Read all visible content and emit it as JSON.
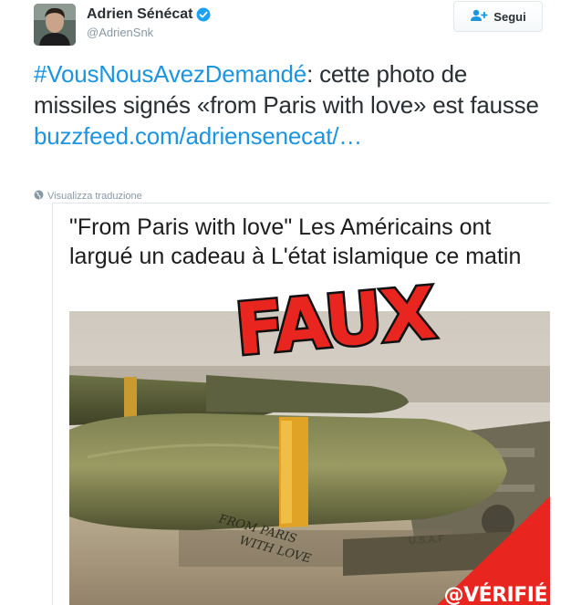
{
  "author": {
    "name": "Adrien Sénécat",
    "handle": "@AdrienSnk",
    "verified": true
  },
  "follow_button": {
    "label": "Segui",
    "icon": "add-user-icon"
  },
  "tweet": {
    "hashtag": "#VousNousAvezDemandé",
    "text": ": cette photo de missiles signés «from Paris with love» est fausse",
    "link": "buzzfeed.com/adriensenecat/…"
  },
  "translate": {
    "label": "Visualizza traduzione",
    "icon": "globe-icon"
  },
  "media": {
    "caption": "\"From Paris with love\" Les Américains ont largué un cadeau à L'état islamique ce matin",
    "stamp": "FAUX",
    "handwriting": [
      "FROM PARIS",
      "WITH LOVE"
    ],
    "badge": "@VÉRIFIÉ",
    "watermark": "U.S.A.F"
  },
  "colors": {
    "link": "#1b95e0",
    "verified": "#1da1f2",
    "stamp_red": "#e8251f",
    "muted": "#8899a6"
  }
}
